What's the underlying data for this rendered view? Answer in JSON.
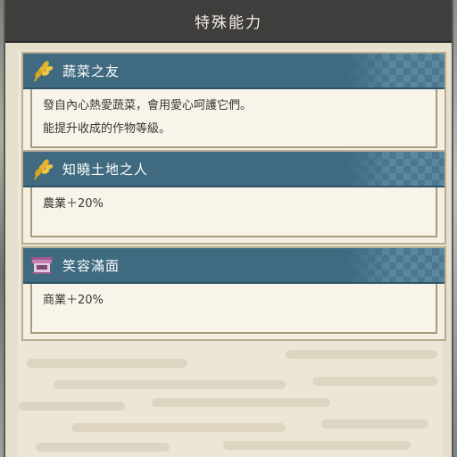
{
  "window": {
    "title": "特殊能力"
  },
  "abilities": [
    {
      "icon": "wheat-icon",
      "title": "蔬菜之友",
      "lines": [
        "發自內心熱愛蔬菜，會用愛心呵護它們。",
        "能提升收成的作物等級。"
      ]
    },
    {
      "icon": "wheat-icon",
      "title": "知曉土地之人",
      "lines": [
        "農業＋20%"
      ]
    },
    {
      "icon": "shop-icon",
      "title": "笑容滿面",
      "lines": [
        "商業＋20%"
      ]
    }
  ],
  "colors": {
    "titlebar": "#3f3e3c",
    "card_header": "#3f6a80",
    "panel": "#ece6d6",
    "wheat_icon": "#d8a421",
    "shop_icon": "#c77fb4"
  }
}
